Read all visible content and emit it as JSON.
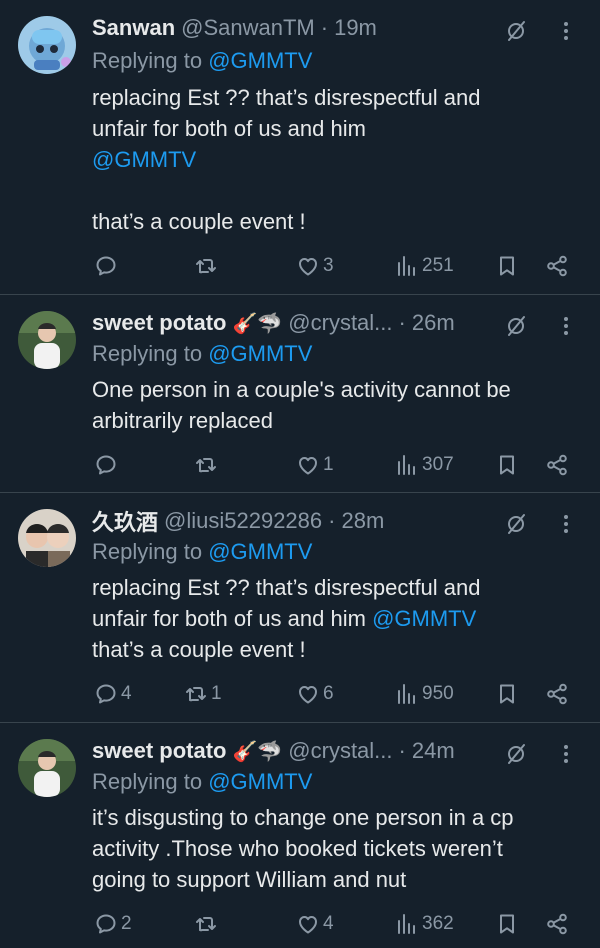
{
  "tweets": [
    {
      "name": "Sanwan",
      "emoji": "",
      "handle": "@SanwanTM",
      "time": "19m",
      "replying_prefix": "Replying to",
      "replying_to": "@GMMTV",
      "body_lines": [
        "replacing Est ?? that’s disrespectful and",
        "unfair for both of us and him"
      ],
      "body_mention": "@GMMTV",
      "body_after": "that’s a couple event !",
      "replies": "",
      "retweets": "",
      "likes": "3",
      "views": "251"
    },
    {
      "name": "sweet potato",
      "emoji": "🎸🦈",
      "handle": "@crystal...",
      "time": "26m",
      "replying_prefix": "Replying to",
      "replying_to": "@GMMTV",
      "body_lines": [
        "One person in a couple's activity cannot be",
        "arbitrarily replaced"
      ],
      "replies": "",
      "retweets": "",
      "likes": "1",
      "views": "307"
    },
    {
      "name": "久玖酒",
      "emoji": "",
      "handle": "@liusi52292286",
      "time": "28m",
      "replying_prefix": "Replying to",
      "replying_to": "@GMMTV",
      "body_line1": "replacing Est ?? that’s disrespectful and",
      "body_line2_text": "unfair for both of us and him ",
      "body_line2_mention": "@GMMTV",
      "body_line3": "that’s a couple event !",
      "replies": "4",
      "retweets": "1",
      "likes": "6",
      "views": "950"
    },
    {
      "name": "sweet potato",
      "emoji": "🎸🦈",
      "handle": "@crystal...",
      "time": "24m",
      "replying_prefix": "Replying to",
      "replying_to": "@GMMTV",
      "body_lines": [
        "it’s disgusting to change one person in a cp",
        "activity .Those who booked tickets weren’t",
        "going to support William and nut"
      ],
      "replies": "2",
      "retweets": "",
      "likes": "4",
      "views": "362"
    }
  ],
  "icons": {
    "reply": "reply-icon",
    "retweet": "retweet-icon",
    "like": "heart-icon",
    "views": "views-icon",
    "bookmark": "bookmark-icon",
    "share": "share-icon",
    "grok": "grok-icon",
    "more": "more-icon"
  },
  "colors": {
    "background": "#15202b",
    "text": "#e7e9ea",
    "muted": "#8b98a5",
    "link": "#1d9bf0",
    "divider": "#38444d"
  }
}
